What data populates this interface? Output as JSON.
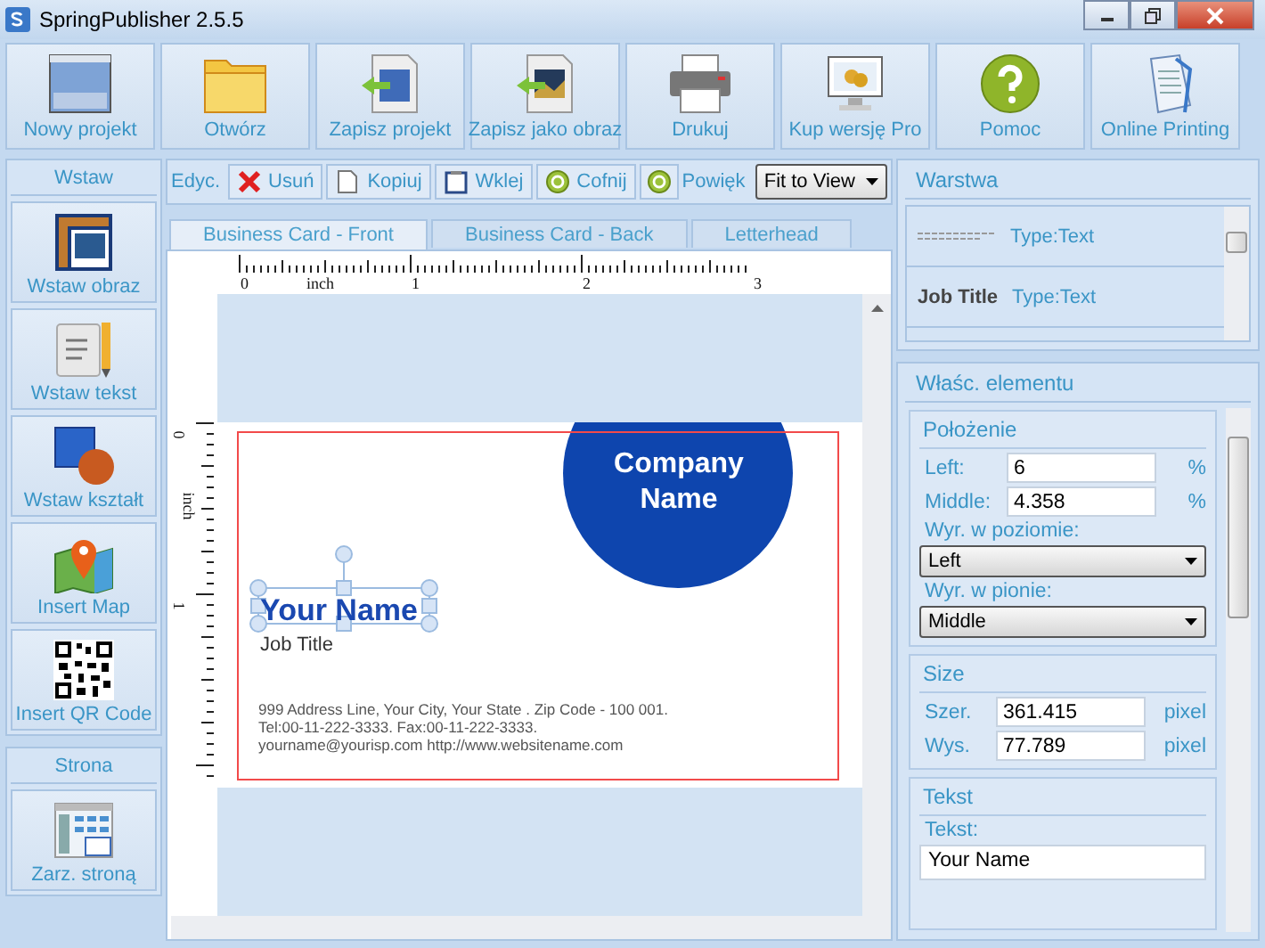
{
  "window": {
    "title": "SpringPublisher 2.5.5"
  },
  "toolbar": [
    "Nowy projekt",
    "Otwórz",
    "Zapisz projekt",
    "Zapisz jako obraz",
    "Drukuj",
    "Kup wersję Pro",
    "Pomoc",
    "Online Printing"
  ],
  "insert_panel": {
    "title": "Wstaw",
    "items": [
      "Wstaw obraz",
      "Wstaw tekst",
      "Wstaw kształt",
      "Insert Map",
      "Insert QR Code"
    ]
  },
  "page_panel": {
    "title": "Strona",
    "items": [
      "Zarz. stroną"
    ]
  },
  "edit_toolbar": {
    "label": "Edyc.",
    "buttons": [
      "Usuń",
      "Kopiuj",
      "Wklej",
      "Cofnij"
    ],
    "zoom_label": "Powięk",
    "zoom_select": "Fit to View"
  },
  "tabs": [
    {
      "label": "Business Card - Front",
      "selected": true
    },
    {
      "label": "Business Card - Back",
      "selected": false
    },
    {
      "label": "Letterhead",
      "selected": false
    }
  ],
  "ruler": {
    "horizontal": [
      "0",
      "inch",
      "1",
      "2",
      "3"
    ],
    "vertical": [
      "0",
      "inch",
      "1"
    ]
  },
  "card": {
    "company_name": "Company Name",
    "name": "Your Name",
    "name_selected": true,
    "job_title": "Job Title",
    "address_lines": [
      "999 Address Line, Your City, Your State .  Zip Code - 100 001.",
      "Tel:00-11-222-3333. Fax:00-11-222-3333.",
      "yourname@yourisp.com  http://www.websitename.com"
    ]
  },
  "layers": {
    "title": "Warstwa",
    "items": [
      {
        "kind": "preview",
        "type": "Type:Text"
      },
      {
        "kind": "text",
        "name": "Job Title",
        "type": "Type:Text"
      }
    ]
  },
  "properties": {
    "title": "Właśc. elementu",
    "position": {
      "title": "Położenie",
      "fields": [
        {
          "label": "Left:",
          "value": "6",
          "unit": "%"
        },
        {
          "label": "Middle:",
          "value": "4.358",
          "unit": "%"
        }
      ],
      "selects": [
        {
          "label": "Wyr. w poziomie:",
          "value": "Left"
        },
        {
          "label": "Wyr. w pionie:",
          "value": "Middle"
        }
      ]
    },
    "size": {
      "title": "Size",
      "fields": [
        {
          "label": "Szer.",
          "value": "361.415",
          "unit": "pixel"
        },
        {
          "label": "Wys.",
          "value": "77.789",
          "unit": "pixel"
        }
      ]
    },
    "text": {
      "title": "Tekst",
      "label": "Tekst:",
      "value": "Your Name"
    }
  }
}
